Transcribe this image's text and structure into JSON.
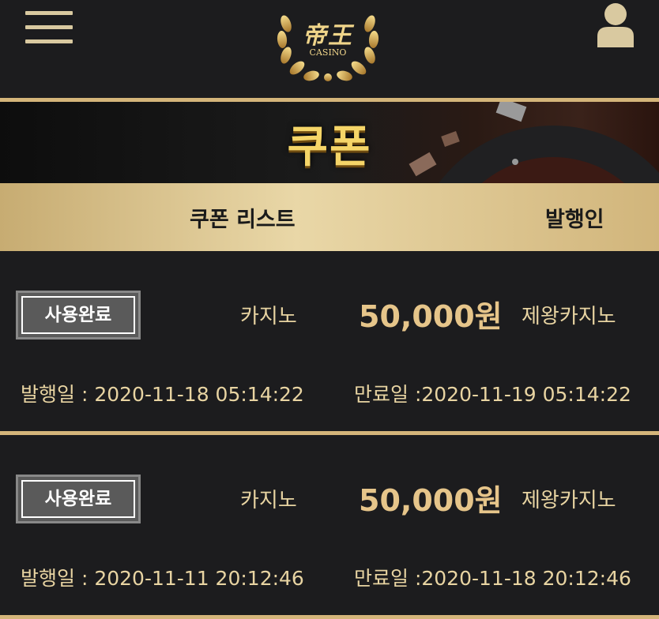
{
  "header": {
    "logo_text": "帝王",
    "logo_sub": "CASINO"
  },
  "banner": {
    "title": "쿠폰"
  },
  "table_header": {
    "list_label": "쿠폰 리스트",
    "issuer_label": "발행인"
  },
  "coupons": [
    {
      "status": "사용완료",
      "type": "카지노",
      "amount": "50,000원",
      "issuer": "제왕카지노",
      "issued": "발행일 : 2020-11-18 05:14:22",
      "expires": "만료일 :2020-11-19 05:14:22"
    },
    {
      "status": "사용완료",
      "type": "카지노",
      "amount": "50,000원",
      "issuer": "제왕카지노",
      "issued": "발행일 : 2020-11-11 20:12:46",
      "expires": "만료일 :2020-11-18 20:12:46"
    }
  ],
  "colors": {
    "gold": "#d4b57a",
    "background": "#1c1c1e",
    "accent_text": "#e6c58a"
  },
  "icons": {
    "menu": "hamburger-menu-icon",
    "user": "user-icon",
    "logo": "laurel-wreath-logo"
  }
}
